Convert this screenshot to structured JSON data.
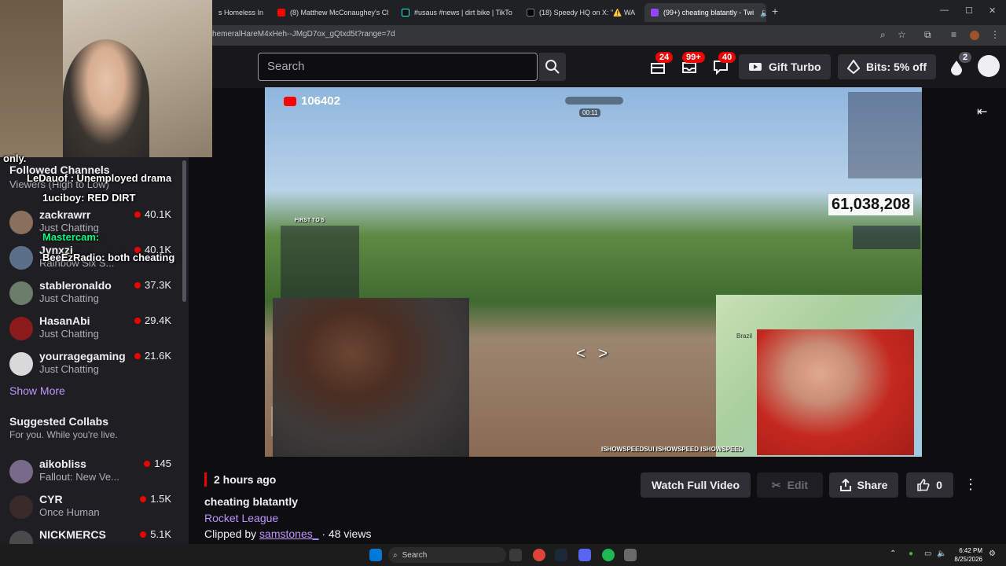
{
  "browser": {
    "tabs": [
      {
        "label": "s Homeless In"
      },
      {
        "label": "(8) Matthew McConaughey's Cl"
      },
      {
        "label": "#usaus #news | dirt bike | TikTo"
      },
      {
        "label": "(18) Speedy HQ on X: \"⚠️ WA"
      },
      {
        "label": "(99+) cheating blatantly - Twi"
      }
    ],
    "url": "hemeralHareM4xHeh--JMgD7ox_gQtxd5t?range=7d",
    "new_tab": "+"
  },
  "topnav": {
    "search_placeholder": "Search",
    "badges": [
      "24",
      "99+",
      "40"
    ],
    "gift_turbo": "Gift Turbo",
    "bits": "Bits: 5% off",
    "notif_count": "2"
  },
  "overlay_chat": [
    {
      "text": "only."
    },
    {
      "text": "LeDauof : Unemployed drama"
    },
    {
      "text": "1uciboy: RED DIRT"
    },
    {
      "text": "zackrawrr"
    },
    {
      "text": "Mastercam:"
    },
    {
      "text": "BeeEzRadio: both cheating"
    }
  ],
  "sidebar": {
    "followed_title": "Followed Channels",
    "followed_sub": "Viewers (High to Low)",
    "followed": [
      {
        "name": "zackrawrr",
        "game": "Just Chatting",
        "viewers": "40.1K"
      },
      {
        "name": "Jynxzi",
        "game": "Rainbow Six S...",
        "viewers": "40.1K"
      },
      {
        "name": "stableronaldo",
        "game": "Just Chatting",
        "viewers": "37.3K"
      },
      {
        "name": "HasanAbi",
        "game": "Just Chatting",
        "viewers": "29.4K"
      },
      {
        "name": "yourragegaming",
        "game": "Just Chatting",
        "viewers": "21.6K"
      }
    ],
    "show_more": "Show More",
    "collabs_title": "Suggested Collabs",
    "collabs_sub": "For you. While you're live.",
    "collabs": [
      {
        "name": "aikobliss",
        "game": "Fallout: New Ve...",
        "viewers": "145"
      },
      {
        "name": "CYR",
        "game": "Once Human",
        "viewers": "1.5K"
      },
      {
        "name": "NICKMERCS",
        "game": "",
        "viewers": "5.1K"
      }
    ]
  },
  "player": {
    "yt_subs": "106402",
    "big_counter": "61,038,208",
    "map_label": "Brazil",
    "timer": "00:11",
    "first_to": "FIRST TO 5",
    "handles": "ISHOWSPEEDSUI  ISHOWSPEED  ISHOWSPEED"
  },
  "clip": {
    "time_ago": "2 hours ago",
    "title": "cheating blatantly",
    "game": "Rocket League",
    "clipped_by_prefix": "Clipped by",
    "author": "samstones_",
    "views": "· 48 views",
    "watch_full": "Watch Full Video",
    "edit": "Edit",
    "share": "Share",
    "likes": "0"
  },
  "taskbar": {
    "search": "Search",
    "time": "6:42 PM",
    "date": "8/25/2026"
  },
  "colors": {
    "accent": "#9147ff",
    "live_red": "#eb0400",
    "link_purple": "#bf94ff",
    "bg": "#0e0e10"
  }
}
